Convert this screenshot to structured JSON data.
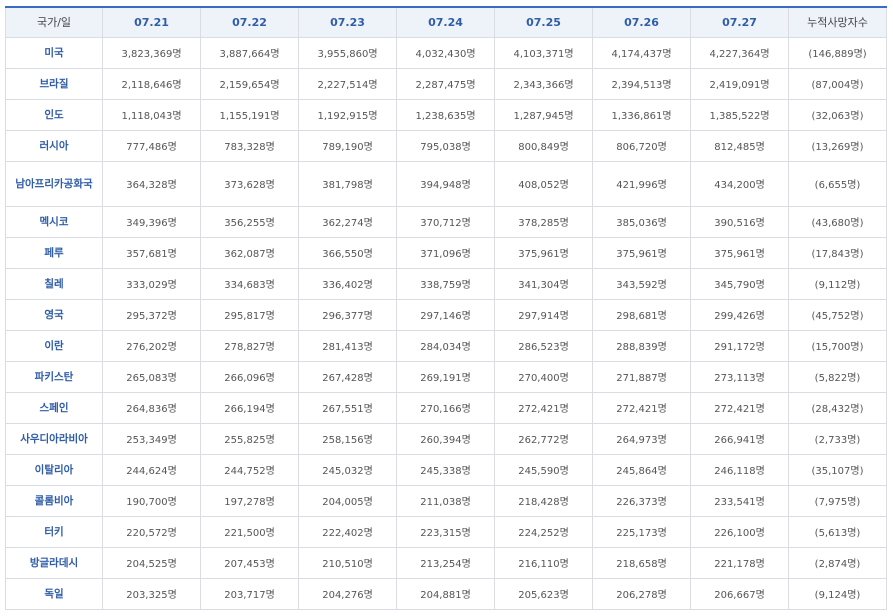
{
  "table": {
    "headers": [
      "국가/일",
      "07.21",
      "07.22",
      "07.23",
      "07.24",
      "07.25",
      "07.26",
      "07.27",
      "누적사망자수"
    ],
    "rows": [
      {
        "country": "미국",
        "values": [
          "3,823,369명",
          "3,887,664명",
          "3,955,860명",
          "4,032,430명",
          "4,103,371명",
          "4,174,437명",
          "4,227,364명"
        ],
        "deaths": "(146,889명)"
      },
      {
        "country": "브라질",
        "values": [
          "2,118,646명",
          "2,159,654명",
          "2,227,514명",
          "2,287,475명",
          "2,343,366명",
          "2,394,513명",
          "2,419,091명"
        ],
        "deaths": "(87,004명)"
      },
      {
        "country": "인도",
        "values": [
          "1,118,043명",
          "1,155,191명",
          "1,192,915명",
          "1,238,635명",
          "1,287,945명",
          "1,336,861명",
          "1,385,522명"
        ],
        "deaths": "(32,063명)"
      },
      {
        "country": "러시아",
        "values": [
          "777,486명",
          "783,328명",
          "789,190명",
          "795,038명",
          "800,849명",
          "806,720명",
          "812,485명"
        ],
        "deaths": "(13,269명)"
      },
      {
        "country": "남아프리카공화국",
        "values": [
          "364,328명",
          "373,628명",
          "381,798명",
          "394,948명",
          "408,052명",
          "421,996명",
          "434,200명"
        ],
        "deaths": "(6,655명)"
      },
      {
        "country": "멕시코",
        "values": [
          "349,396명",
          "356,255명",
          "362,274명",
          "370,712명",
          "378,285명",
          "385,036명",
          "390,516명"
        ],
        "deaths": "(43,680명)"
      },
      {
        "country": "페루",
        "values": [
          "357,681명",
          "362,087명",
          "366,550명",
          "371,096명",
          "375,961명",
          "375,961명",
          "375,961명"
        ],
        "deaths": "(17,843명)"
      },
      {
        "country": "칠레",
        "values": [
          "333,029명",
          "334,683명",
          "336,402명",
          "338,759명",
          "341,304명",
          "343,592명",
          "345,790명"
        ],
        "deaths": "(9,112명)"
      },
      {
        "country": "영국",
        "values": [
          "295,372명",
          "295,817명",
          "296,377명",
          "297,146명",
          "297,914명",
          "298,681명",
          "299,426명"
        ],
        "deaths": "(45,752명)"
      },
      {
        "country": "이란",
        "values": [
          "276,202명",
          "278,827명",
          "281,413명",
          "284,034명",
          "286,523명",
          "288,839명",
          "291,172명"
        ],
        "deaths": "(15,700명)"
      },
      {
        "country": "파키스탄",
        "values": [
          "265,083명",
          "266,096명",
          "267,428명",
          "269,191명",
          "270,400명",
          "271,887명",
          "273,113명"
        ],
        "deaths": "(5,822명)"
      },
      {
        "country": "스페인",
        "values": [
          "264,836명",
          "266,194명",
          "267,551명",
          "270,166명",
          "272,421명",
          "272,421명",
          "272,421명"
        ],
        "deaths": "(28,432명)"
      },
      {
        "country": "사우디아라비아",
        "values": [
          "253,349명",
          "255,825명",
          "258,156명",
          "260,394명",
          "262,772명",
          "264,973명",
          "266,941명"
        ],
        "deaths": "(2,733명)"
      },
      {
        "country": "이탈리아",
        "values": [
          "244,624명",
          "244,752명",
          "245,032명",
          "245,338명",
          "245,590명",
          "245,864명",
          "246,118명"
        ],
        "deaths": "(35,107명)"
      },
      {
        "country": "콜롬비아",
        "values": [
          "190,700명",
          "197,278명",
          "204,005명",
          "211,038명",
          "218,428명",
          "226,373명",
          "233,541명"
        ],
        "deaths": "(7,975명)"
      },
      {
        "country": "터키",
        "values": [
          "220,572명",
          "221,500명",
          "222,402명",
          "223,315명",
          "224,252명",
          "225,173명",
          "226,100명"
        ],
        "deaths": "(5,613명)"
      },
      {
        "country": "방글라데시",
        "values": [
          "204,525명",
          "207,453명",
          "210,510명",
          "213,254명",
          "216,110명",
          "218,658명",
          "221,178명"
        ],
        "deaths": "(2,874명)"
      },
      {
        "country": "독일",
        "values": [
          "203,325명",
          "203,717명",
          "204,276명",
          "204,881명",
          "205,623명",
          "206,278명",
          "206,667명"
        ],
        "deaths": "(9,124명)"
      }
    ]
  }
}
